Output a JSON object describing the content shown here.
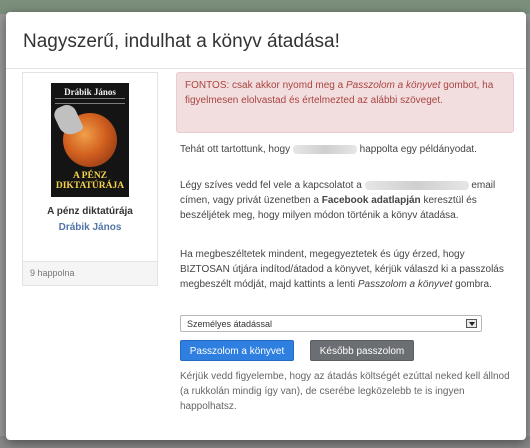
{
  "modal": {
    "title": "Nagyszerű, indulhat a könyv átadása!"
  },
  "book": {
    "cover_author": "Drábik János",
    "cover_title": "A PÉNZ DIKTATÚRÁJA",
    "title": "A pénz diktatúrája",
    "author": "Drábik János",
    "count": "9 happolna"
  },
  "alert": {
    "part1": "FONTOS: csak akkor nyomd meg a ",
    "part1_em": "Passzolom a könyvet",
    "part2": " gombot, ha figyelmesen elolvastad és értelmezted az alábbi szöveget."
  },
  "paragraph1": {
    "before": "Tehát ott tartottunk, hogy ",
    "after": " happolta egy példányodat."
  },
  "paragraph2": {
    "before": "Légy szíves vedd fel vele a kapcsolatot a ",
    "middle": " email címen, vagy privát üzenetben a ",
    "bold": "Facebook adatlapján",
    "after": " keresztül és beszéljétek meg, hogy milyen módon történik a könyv átadása."
  },
  "paragraph3": {
    "text": "Ha megbeszéltetek mindent, megegyeztetek és úgy érzed, hogy BIZTOSAN útjára indítod/átadod a könyvet, kérjük válaszd ki a passzolás megbeszélt módját, majd kattints a lenti ",
    "em": "Passzolom a könyvet",
    "after": " gombra."
  },
  "select": {
    "value": "Személyes átadással"
  },
  "buttons": {
    "pass": "Passzolom a könyvet",
    "later": "Később passzolom"
  },
  "paragraph4": {
    "text": "Kérjük vedd figyelembe, hogy az átadás költségét ezúttal neked kell állnod (a rukkolán mindig így van), de cserébe legközelebb te is ingyen happolhatsz."
  },
  "colors": {
    "primary": "#2f7fe0",
    "secondary": "#6b6f73",
    "alert_bg": "#f2dede",
    "alert_text": "#a94442",
    "author_link": "#5276a8"
  }
}
